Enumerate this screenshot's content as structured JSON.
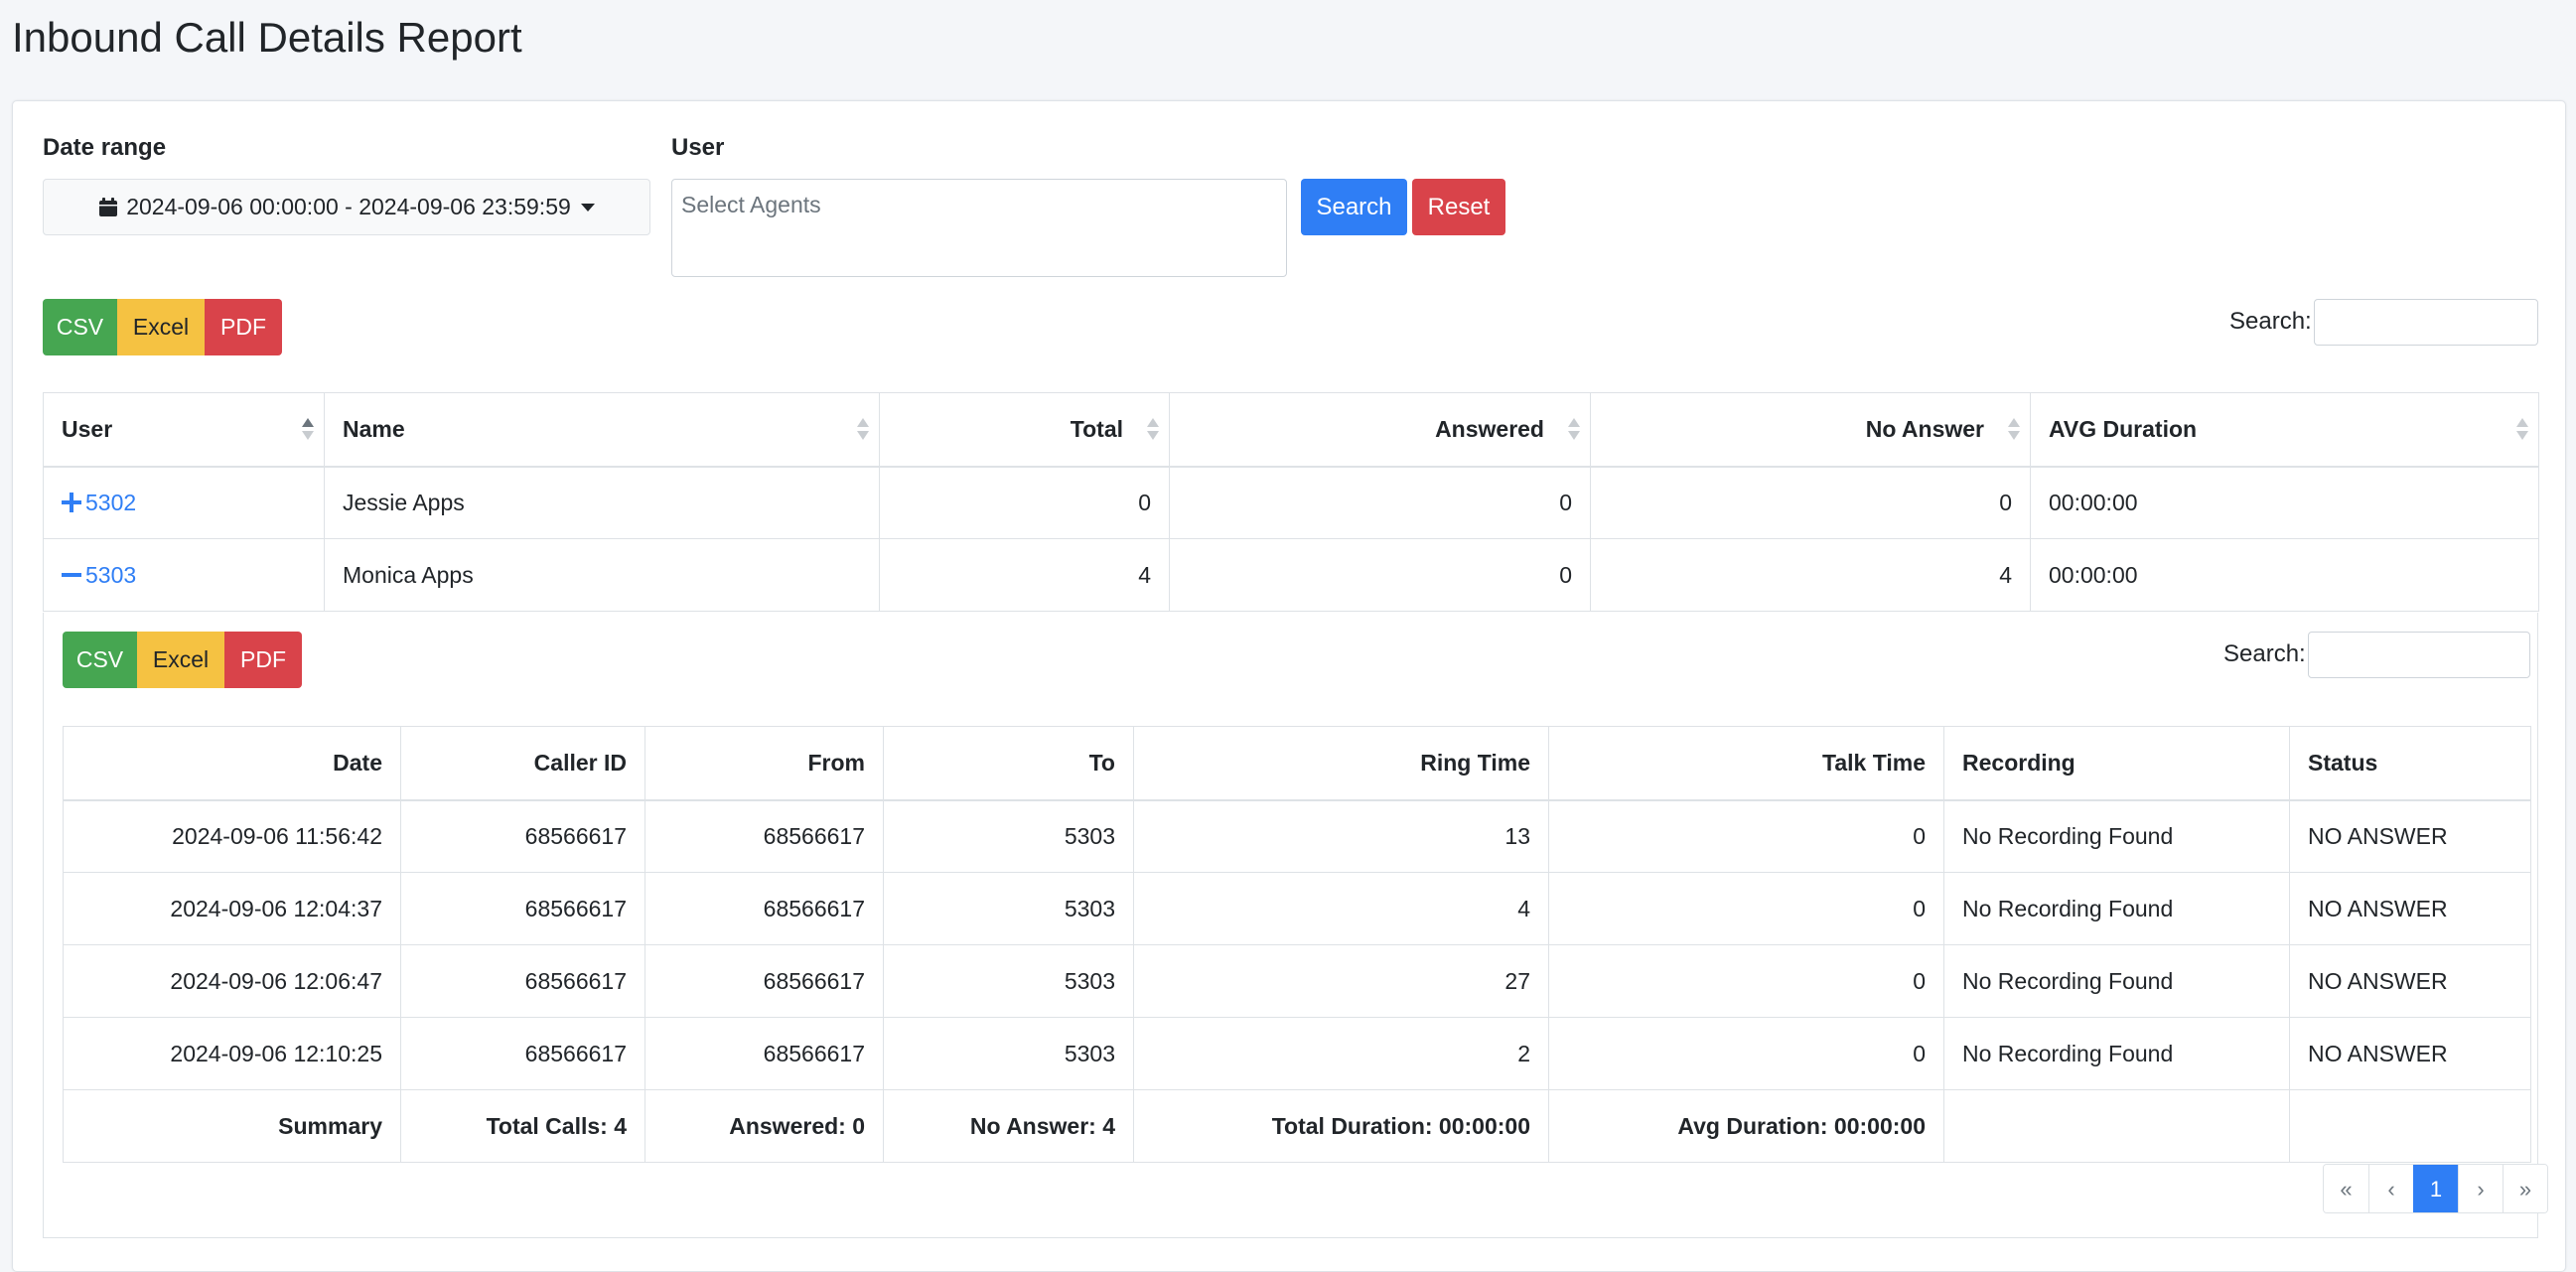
{
  "page": {
    "title": "Inbound Call Details Report"
  },
  "filters": {
    "date_label": "Date range",
    "date_value": "2024-09-06 00:00:00 - 2024-09-06 23:59:59",
    "user_label": "User",
    "agents_placeholder": "Select Agents",
    "search_button": "Search",
    "reset_button": "Reset"
  },
  "export": {
    "csv": "CSV",
    "excel": "Excel",
    "pdf": "PDF"
  },
  "search_label": "Search:",
  "main_table": {
    "columns": [
      "User",
      "Name",
      "Total",
      "Answered",
      "No Answer",
      "AVG Duration"
    ],
    "rows": [
      {
        "user": "5302",
        "name": "Jessie Apps",
        "total": "0",
        "answered": "0",
        "no_answer": "0",
        "avg_duration": "00:00:00",
        "expanded": false
      },
      {
        "user": "5303",
        "name": "Monica Apps",
        "total": "4",
        "answered": "0",
        "no_answer": "4",
        "avg_duration": "00:00:00",
        "expanded": true
      }
    ]
  },
  "detail_table": {
    "columns": [
      "Date",
      "Caller ID",
      "From",
      "To",
      "Ring Time",
      "Talk Time",
      "Recording",
      "Status"
    ],
    "rows": [
      {
        "date": "2024-09-06 11:56:42",
        "caller_id": "68566617",
        "from": "68566617",
        "to": "5303",
        "ring_time": "13",
        "talk_time": "0",
        "recording": "No Recording Found",
        "status": "NO ANSWER"
      },
      {
        "date": "2024-09-06 12:04:37",
        "caller_id": "68566617",
        "from": "68566617",
        "to": "5303",
        "ring_time": "4",
        "talk_time": "0",
        "recording": "No Recording Found",
        "status": "NO ANSWER"
      },
      {
        "date": "2024-09-06 12:06:47",
        "caller_id": "68566617",
        "from": "68566617",
        "to": "5303",
        "ring_time": "27",
        "talk_time": "0",
        "recording": "No Recording Found",
        "status": "NO ANSWER"
      },
      {
        "date": "2024-09-06 12:10:25",
        "caller_id": "68566617",
        "from": "68566617",
        "to": "5303",
        "ring_time": "2",
        "talk_time": "0",
        "recording": "No Recording Found",
        "status": "NO ANSWER"
      }
    ],
    "summary": {
      "label": "Summary",
      "total_calls": "Total Calls: 4",
      "answered": "Answered: 0",
      "no_answer": "No Answer: 4",
      "total_duration": "Total Duration: 00:00:00",
      "avg_duration": "Avg Duration: 00:00:00"
    }
  },
  "pagination": {
    "first": "«",
    "prev": "‹",
    "current": "1",
    "next": "›",
    "last": "»"
  },
  "colors": {
    "primary": "#2f7ef5",
    "danger": "#d9434a",
    "success": "#46a651",
    "warning": "#f5c242"
  }
}
